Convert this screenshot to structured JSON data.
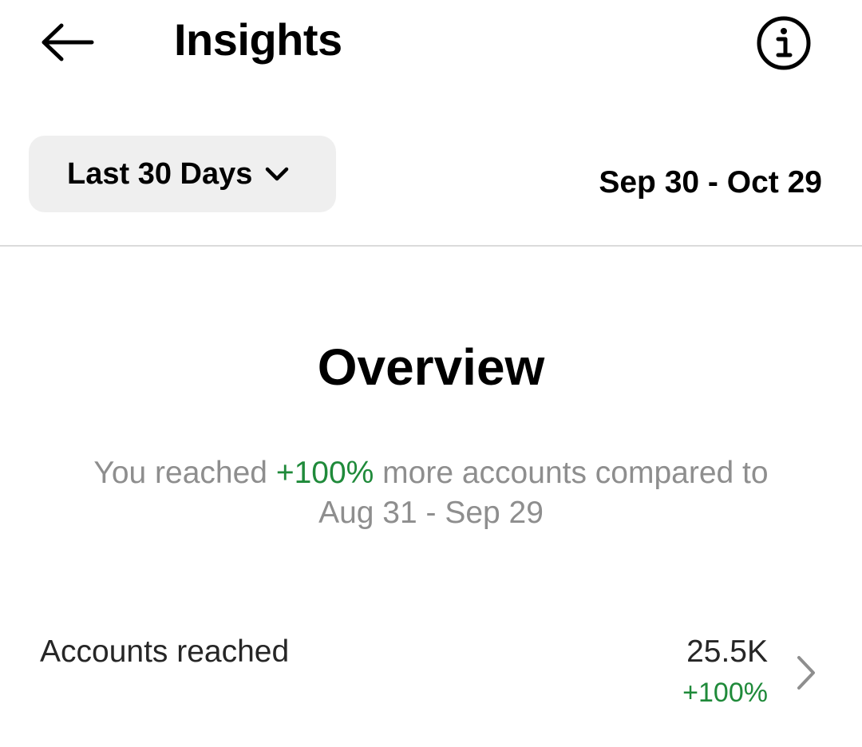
{
  "header": {
    "title": "Insights",
    "back_icon": "arrow-left-icon",
    "info_icon": "info-circle-icon"
  },
  "filter": {
    "range_label": "Last 30 Days",
    "range_icon": "chevron-down-icon",
    "date_range": "Sep 30 - Oct 29"
  },
  "overview": {
    "heading": "Overview",
    "summary_prefix": "You reached ",
    "summary_highlight": "+100%",
    "summary_suffix": " more accounts compared to Aug 31 - Sep 29"
  },
  "metrics": [
    {
      "label": "Accounts reached",
      "value": "25.5K",
      "change": "+100%",
      "icon": "chevron-right-icon"
    }
  ],
  "colors": {
    "positive": "#1f8a3a",
    "muted_text": "#8e8e8e",
    "dropdown_bg": "#efefef",
    "divider": "#dbdbdb"
  }
}
